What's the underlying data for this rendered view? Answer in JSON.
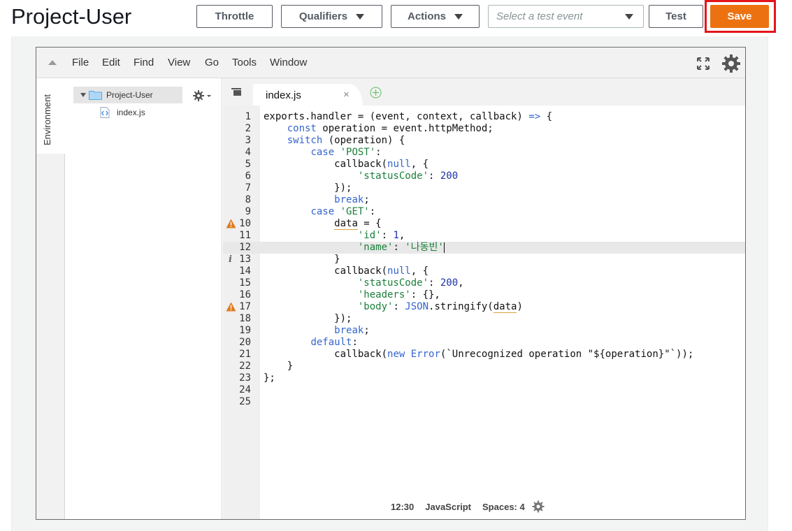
{
  "page": {
    "title": "Project-User"
  },
  "toolbar": {
    "throttle": "Throttle",
    "qualifiers": "Qualifiers",
    "actions": "Actions",
    "test_event_placeholder": "Select a test event",
    "test": "Test",
    "save": "Save"
  },
  "colors": {
    "save_bg": "#ec7211",
    "highlight_frame": "#e3151b"
  },
  "ide": {
    "menu": [
      "File",
      "Edit",
      "Find",
      "View",
      "Go",
      "Tools",
      "Window"
    ],
    "environment_label": "Environment",
    "tree": {
      "root": "Project-User",
      "file": "index.js"
    },
    "tab": {
      "name": "index.js",
      "close": "×"
    },
    "status": {
      "position": "12:30",
      "language": "JavaScript",
      "spaces": "Spaces: 4"
    }
  },
  "code": {
    "lines": [
      "1",
      "2",
      "3",
      "4",
      "5",
      "6",
      "7",
      "8",
      "9",
      "10",
      "11",
      "12",
      "13",
      "14",
      "15",
      "16",
      "17",
      "18",
      "19",
      "20",
      "21",
      "22",
      "23",
      "24",
      "25"
    ],
    "l1": "exports.handler = (event, context, callback) ",
    "l1_arrow": "=>",
    "l1_tail": " {",
    "const": "const",
    "l2_tail": " operation = event.httpMethod;",
    "switch": "switch",
    "l3_tail": " (operation) {",
    "case": "case",
    "post": "'POST'",
    "colon": ":",
    "callback_open": "callback(",
    "null": "null",
    "comma_brace": ", {",
    "statusCode": "'statusCode'",
    "colon_sp": ": ",
    "n200": "200",
    "close_paren": "});",
    "break": "break",
    "semi": ";",
    "get": "'GET'",
    "data": "data",
    "assign_open": " = {",
    "id": "'id'",
    "n1": "1",
    "comma": ",",
    "name": "'name'",
    "name_val": "'나동빈'",
    "close_brace": "}",
    "headers": "'headers'",
    "headers_val": "{},",
    "body": "'body'",
    "json": "JSON",
    "stringify": ".stringify(",
    "stringify_close": ")",
    "default": "default",
    "new": "new",
    "error": "Error",
    "error_msg": "(`Unrecognized operation \"${operation}\"`));",
    "close_fn": "};"
  }
}
